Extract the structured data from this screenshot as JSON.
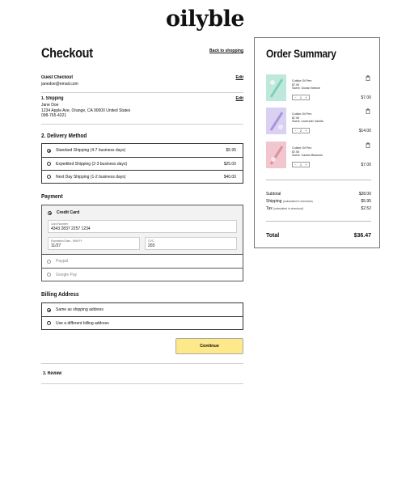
{
  "brand": {
    "logo": "oilyble"
  },
  "checkout": {
    "title": "Checkout",
    "back_link": "Back to shopping",
    "guest": {
      "heading": "Guest Checkout",
      "edit": "Edit",
      "email": "janedoe@email.com"
    },
    "shipping": {
      "heading": "1. Shipping",
      "edit": "Edit",
      "name": "Jane Doe",
      "address": "1234 Apple Ave, Orange, CA 90000 United States",
      "phone": "098-765-4321"
    },
    "delivery": {
      "heading": "2. Delivery Method",
      "options": [
        {
          "label": "Standard Shipping (4-7 business days)",
          "price": "$5.95",
          "selected": true
        },
        {
          "label": "Expedited Shipping (2-3 business days)",
          "price": "$25.00",
          "selected": false
        },
        {
          "label": "Next Day Shipping (1-2 business days)",
          "price": "$40.00",
          "selected": false
        }
      ]
    },
    "payment": {
      "heading": "Payment",
      "credit_card_label": "Credit Card",
      "card_number_label": "Card Number",
      "card_number": "4343 2837 2257 1234",
      "expiry_label": "Expiration Date - MM/YY",
      "expiry": "11/27",
      "cvc_label": "CVC",
      "cvc": "203",
      "paypal": "Paypal",
      "google_pay": "Google Pay"
    },
    "billing": {
      "heading": "Billing Address",
      "options": [
        {
          "label": "Same as shipping address",
          "selected": true
        },
        {
          "label": "Use a different billing address",
          "selected": false
        }
      ]
    },
    "continue_label": "Continue",
    "review_heading": "3. Review"
  },
  "summary": {
    "title": "Order Summary",
    "items": [
      {
        "name": "Cuticle Oil Pen",
        "unit_price": "$7.00",
        "scent": "Scent: Ocean Breeze",
        "qty": "1",
        "price": "$7.00",
        "color": "#bfe8dc",
        "thumb_icon": "pen-product-image"
      },
      {
        "name": "Cuticle Oil Pen",
        "unit_price": "$7.00",
        "scent": "Scent: Lavender Vanilla",
        "qty": "2",
        "price": "$14.00",
        "color": "#d9d0f2",
        "thumb_icon": "pen-product-image"
      },
      {
        "name": "Cuticle Oil Pen",
        "unit_price": "$7.00",
        "scent": "Scent: Cactus Blossom",
        "qty": "1",
        "price": "$7.00",
        "color": "#f1c6cf",
        "thumb_icon": "pen-product-image"
      }
    ],
    "subtotal_label": "Subtotal",
    "subtotal": "$28.00",
    "shipping_label": "Shipping",
    "shipping_note": "(calculated in checkout)",
    "shipping": "$5.95",
    "tax_label": "Tax",
    "tax_note": "(calculated in checkout)",
    "tax": "$2.52",
    "total_label": "Total",
    "total": "$36.47",
    "qty_minus": "−",
    "qty_plus": "+"
  }
}
